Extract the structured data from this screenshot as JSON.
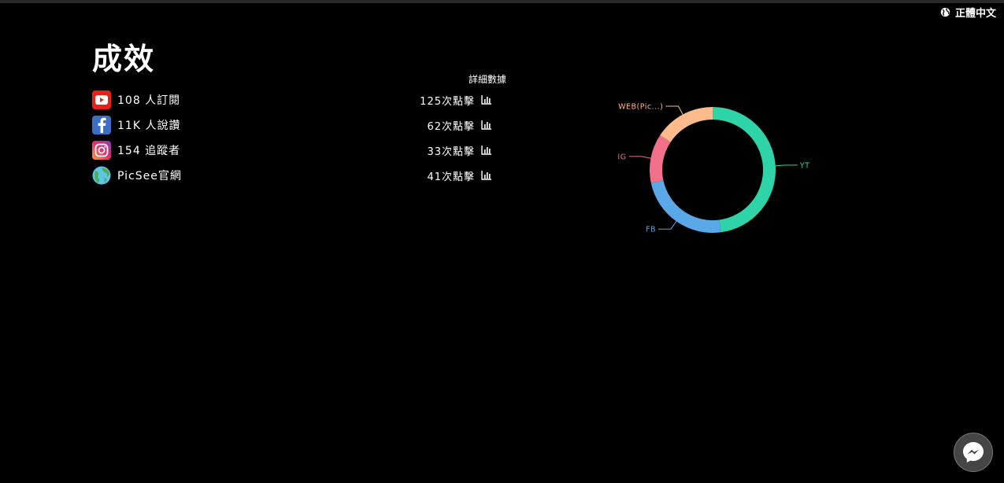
{
  "language": {
    "label": "正體中文",
    "icon": "globe-icon"
  },
  "page": {
    "title": "成效",
    "detail_header": "詳細數據"
  },
  "rows": [
    {
      "id": "yt",
      "icon": "youtube-icon",
      "label": "108 人訂閱",
      "clicks": "125次點擊",
      "color": "#e62117"
    },
    {
      "id": "fb",
      "icon": "facebook-icon",
      "label": "11K 人說讚",
      "clicks": "62次點擊",
      "color": "#3b6fc4"
    },
    {
      "id": "ig",
      "icon": "instagram-icon",
      "label": "154 追蹤者",
      "clicks": "33次點擊",
      "color": "#c13584"
    },
    {
      "id": "web",
      "icon": "globe-site-icon",
      "label": "PicSee官網",
      "clicks": "41次點擊",
      "color": "#3dbd8c"
    }
  ],
  "chart_data": {
    "type": "pie",
    "donut": true,
    "labels": [
      "YT",
      "FB",
      "IG",
      "WEB(Pic...)"
    ],
    "values": [
      125,
      62,
      33,
      41
    ],
    "colors": [
      "#2ed3a8",
      "#5aa8e8",
      "#f2708a",
      "#fdba8a"
    ]
  },
  "messenger": {
    "icon": "messenger-icon"
  }
}
